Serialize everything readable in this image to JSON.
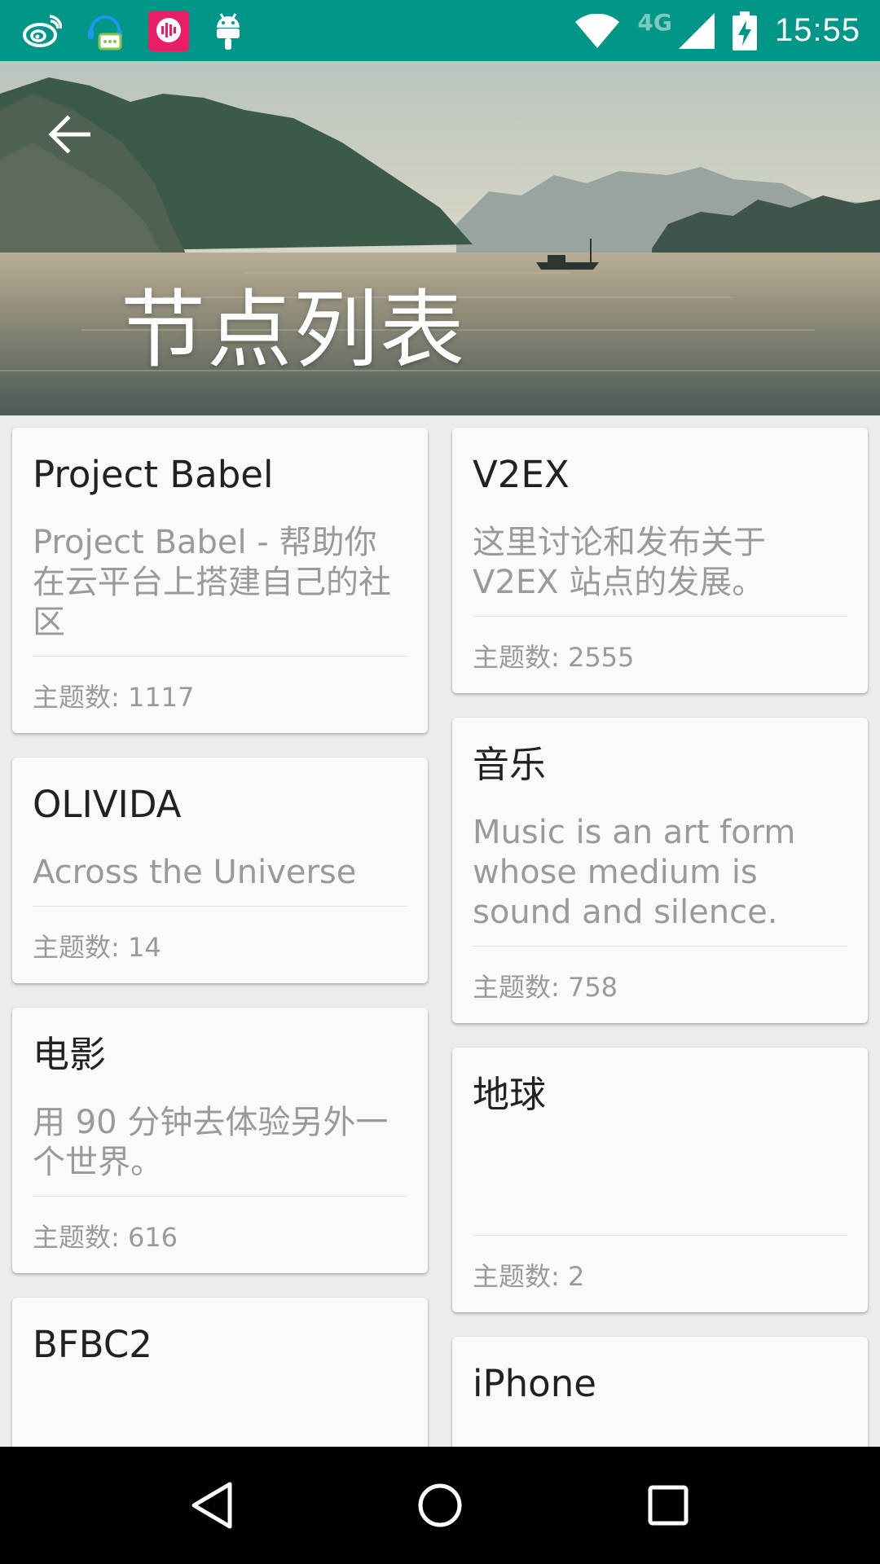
{
  "status_bar": {
    "time": "15:55",
    "network": "4G",
    "left_icons": [
      "weibo-icon",
      "chat-assistant-icon",
      "voice-app-icon",
      "android-icon"
    ],
    "right_icons": [
      "wifi-icon",
      "cell-signal-icon",
      "battery-charging-icon"
    ]
  },
  "header": {
    "title": "节点列表",
    "back_icon": "arrow-back-icon"
  },
  "columns": {
    "left": [
      {
        "title": "Project Babel",
        "desc": "Project Babel - 帮助你在云平台上搭建自己的社区",
        "count": "主题数: 1117"
      },
      {
        "title": "OLIVIDA",
        "desc": "Across the Universe",
        "count": "主题数: 14"
      },
      {
        "title": "电影",
        "desc": "用 90 分钟去体验另外一个世界。",
        "count": "主题数: 616"
      },
      {
        "title": "BFBC2",
        "desc": "",
        "count": ""
      }
    ],
    "right": [
      {
        "title": "V2EX",
        "desc": "这里讨论和发布关于 V2EX 站点的发展。",
        "count": "主题数: 2555"
      },
      {
        "title": "音乐",
        "desc": "Music is an art form whose medium is sound and silence.",
        "count": "主题数: 758"
      },
      {
        "title": "地球",
        "desc": "",
        "count": "主题数: 2"
      },
      {
        "title": "iPhone",
        "desc": "",
        "count": ""
      }
    ]
  },
  "nav_bar": {
    "icons": [
      "nav-back-icon",
      "nav-home-icon",
      "nav-recents-icon"
    ]
  },
  "colors": {
    "status_bar": "#009688",
    "card_bg": "#fafafa",
    "page_bg": "#ececec",
    "title_text": "#212121",
    "secondary_text": "#9a9a9a"
  }
}
